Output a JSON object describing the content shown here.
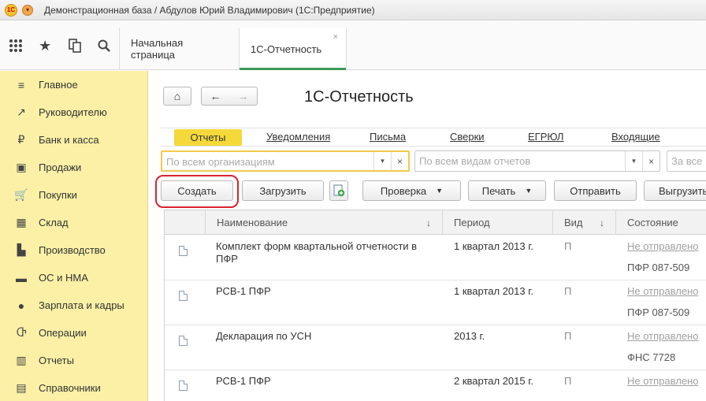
{
  "window": {
    "title": "Демонстрационная база / Абдулов Юрий Владимирович  (1С:Предприятие)",
    "logo_text": "1С"
  },
  "top_icons": [
    {
      "name": "apps-grid-icon",
      "glyph": "⋮⋮"
    },
    {
      "name": "favorites-star-icon",
      "glyph": "★"
    },
    {
      "name": "history-icon",
      "glyph": "⧉"
    },
    {
      "name": "search-icon",
      "glyph": "⌕"
    }
  ],
  "tabs": [
    {
      "label": "Начальная страница"
    },
    {
      "label": "1С-Отчетность",
      "close": "×"
    }
  ],
  "sidebar": {
    "items": [
      {
        "label": "Главное",
        "icon": "≡"
      },
      {
        "label": "Руководителю",
        "icon": "↗"
      },
      {
        "label": "Банк и касса",
        "icon": "₽"
      },
      {
        "label": "Продажи",
        "icon": "▣"
      },
      {
        "label": "Покупки",
        "icon": "🛒"
      },
      {
        "label": "Склад",
        "icon": "▦"
      },
      {
        "label": "Производство",
        "icon": "▙"
      },
      {
        "label": "ОС и НМА",
        "icon": "▬"
      },
      {
        "label": "Зарплата и кадры",
        "icon": "●"
      },
      {
        "label": "Операции",
        "icon": "Ⴇ"
      },
      {
        "label": "Отчеты",
        "icon": "▥"
      },
      {
        "label": "Справочники",
        "icon": "▤"
      }
    ]
  },
  "main": {
    "title": "1С-Отчетность",
    "nav": {
      "home": "⌂",
      "back": "←",
      "forward": "→"
    },
    "filters": {
      "active": "Отчеты",
      "links": [
        "Уведомления",
        "Письма",
        "Сверки",
        "ЕГРЮЛ",
        "Входящие"
      ]
    },
    "combos": {
      "org_placeholder": "По всем организациям",
      "types_placeholder": "По всем видам отчетов",
      "third_placeholder": "За все"
    },
    "buttons": {
      "create": "Создать",
      "load": "Загрузить",
      "check": "Проверка",
      "print": "Печать",
      "send": "Отправить",
      "unload": "Выгрузить"
    },
    "table": {
      "columns": [
        "Наименование",
        "Период",
        "Вид",
        "Состояние"
      ],
      "sort_mark": "↓",
      "rows": [
        {
          "name": "Комплект форм квартальной отчетности в ПФР",
          "period": "1 квартал 2013 г.",
          "kind": "П",
          "status": "Не отправлено",
          "agency": "ПФР 087-509"
        },
        {
          "name": "РСВ-1 ПФР",
          "period": "1 квартал 2013 г.",
          "kind": "П",
          "status": "Не отправлено",
          "agency": "ПФР 087-509"
        },
        {
          "name": "Декларация по УСН",
          "period": "2013 г.",
          "kind": "П",
          "status": "Не отправлено",
          "agency": "ФНС 7728"
        },
        {
          "name": "РСВ-1 ПФР",
          "period": "2 квартал 2015 г.",
          "kind": "П",
          "status": "Не отправлено",
          "agency": ""
        }
      ]
    }
  }
}
